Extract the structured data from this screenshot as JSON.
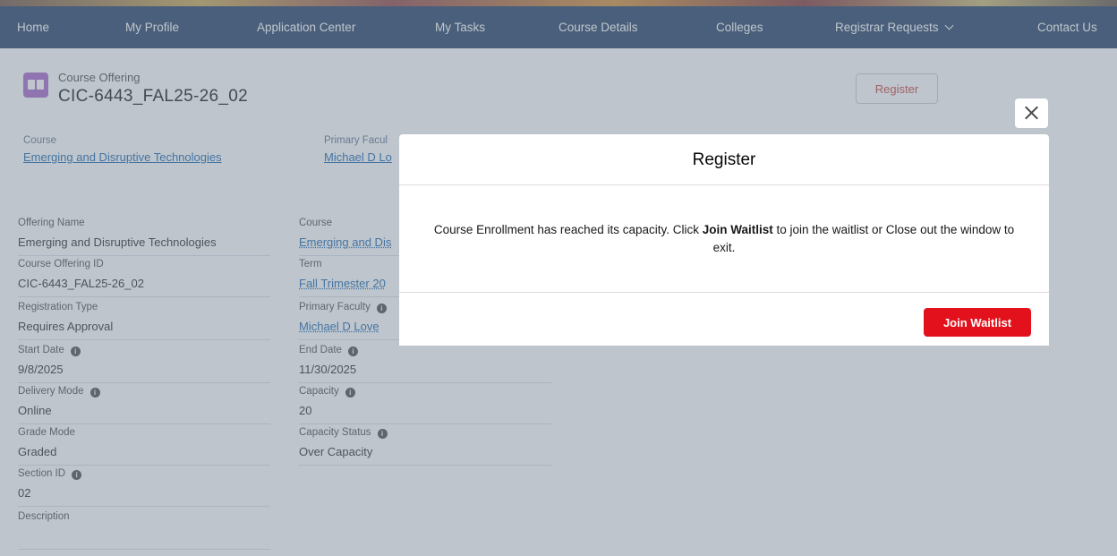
{
  "nav": {
    "items": [
      {
        "label": "Home"
      },
      {
        "label": "My Profile"
      },
      {
        "label": "Application Center"
      },
      {
        "label": "My Tasks"
      },
      {
        "label": "Course Details"
      },
      {
        "label": "Colleges"
      },
      {
        "label": "Registrar Requests"
      },
      {
        "label": "Contact Us"
      }
    ]
  },
  "record": {
    "type_label": "Course Offering",
    "title": "CIC-6443_FAL25-26_02",
    "register_label": "Register",
    "highlights": {
      "course_label": "Course",
      "course_value": "Emerging and Disruptive Technologies",
      "faculty_label": "Primary Facul",
      "faculty_value": "Michael D Lo"
    }
  },
  "details": {
    "left": [
      {
        "label": "Offering Name",
        "value": "Emerging and Disruptive Technologies"
      },
      {
        "label": "Course Offering ID",
        "value": "CIC-6443_FAL25-26_02"
      },
      {
        "label": "Registration Type",
        "value": "Requires Approval"
      },
      {
        "label": "Start Date",
        "value": "9/8/2025"
      },
      {
        "label": "Delivery Mode",
        "value": "Online"
      },
      {
        "label": "Grade Mode",
        "value": "Graded"
      },
      {
        "label": "Section ID",
        "value": "02"
      },
      {
        "label": "Description",
        "value": ""
      }
    ],
    "right": [
      {
        "label": "Course",
        "value": "Emerging and Dis"
      },
      {
        "label": "Term",
        "value": "Fall Trimester 20"
      },
      {
        "label": "Primary Faculty",
        "value": "Michael D Love"
      },
      {
        "label": "End Date",
        "value": "11/30/2025"
      },
      {
        "label": "Capacity",
        "value": "20"
      },
      {
        "label": "Capacity Status",
        "value": "Over Capacity"
      }
    ]
  },
  "modal": {
    "title": "Register",
    "message_before": "Course Enrollment has reached its capacity. Click ",
    "message_bold": "Join Waitlist",
    "message_after": " to join the waitlist or Close out the window to exit.",
    "primary_button": "Join Waitlist"
  },
  "icons": {
    "record": "book-icon",
    "info": "info-icon",
    "close": "close-icon",
    "dropdown": "chevron-down-icon"
  },
  "colors": {
    "nav_bg": "#16325c",
    "record_icon": "#a05cc9",
    "link": "#0b5cab",
    "register_text": "#c23934",
    "primary_button": "#e3111c"
  }
}
